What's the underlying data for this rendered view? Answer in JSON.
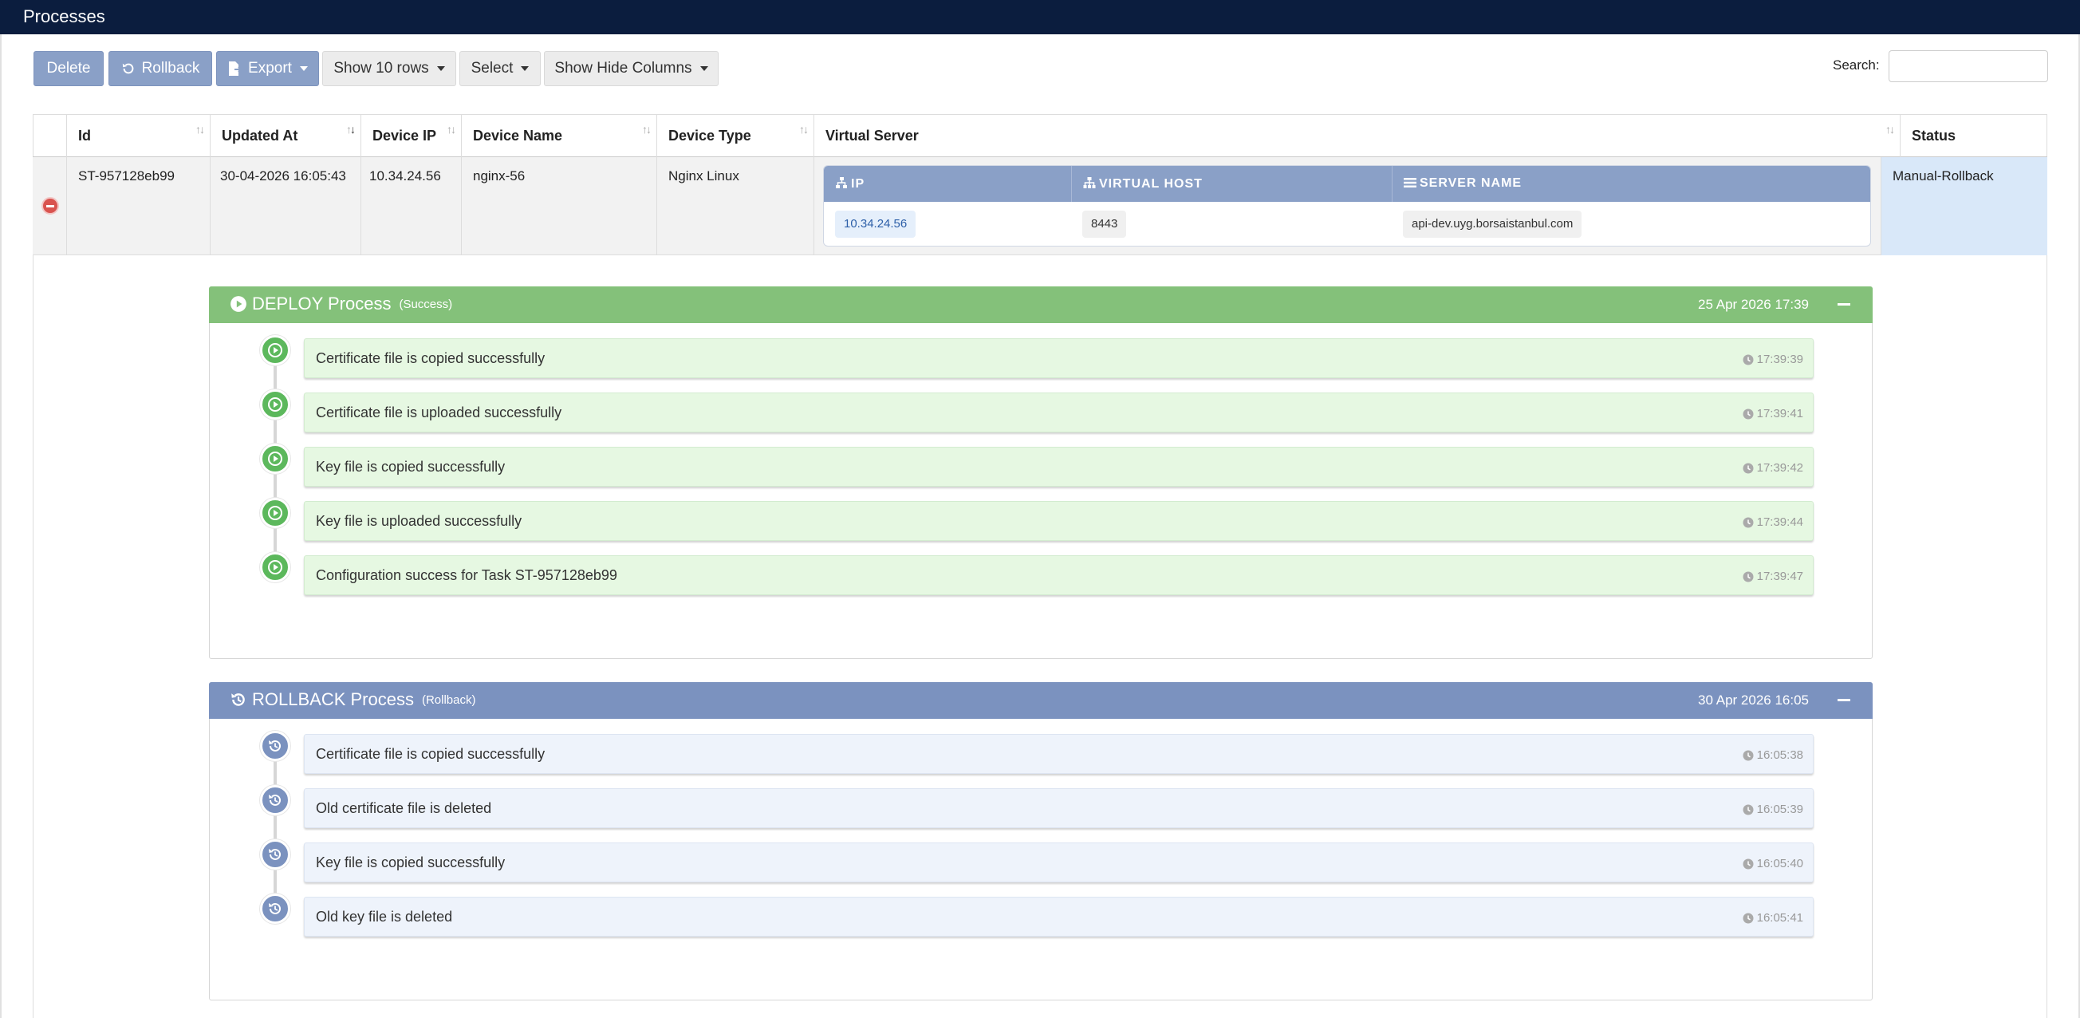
{
  "header": {
    "title": "Processes"
  },
  "toolbar": {
    "delete_label": "Delete",
    "rollback_label": "Rollback",
    "export_label": "Export",
    "rows_label": "Show 10 rows",
    "select_label": "Select",
    "columns_label": "Show Hide Columns",
    "search_label": "Search:",
    "search_value": ""
  },
  "table": {
    "columns": [
      "Id",
      "Updated At",
      "Device IP",
      "Device Name",
      "Device Type",
      "Virtual Server",
      "Status"
    ],
    "row": {
      "id": "ST-957128eb99",
      "updated_at": "30-04-2026 16:05:43",
      "device_ip": "10.34.24.56",
      "device_name": "nginx-56",
      "device_type": "Nginx Linux",
      "status": "Manual-Rollback",
      "virtual_server": {
        "headers": [
          "IP",
          "VIRTUAL HOST",
          "SERVER NAME"
        ],
        "ip": "10.34.24.56",
        "virtual_host": "8443",
        "server_name": "api-dev.uyg.borsaistanbul.com"
      }
    }
  },
  "deploy": {
    "title": "DEPLOY Process",
    "state": "(Success)",
    "date": "25 Apr 2026 17:39",
    "color": "#84c17a",
    "steps": [
      {
        "text": "Certificate file is copied successfully",
        "time": "17:39:39"
      },
      {
        "text": "Certificate file is uploaded successfully",
        "time": "17:39:41"
      },
      {
        "text": "Key file is copied successfully",
        "time": "17:39:42"
      },
      {
        "text": "Key file is uploaded successfully",
        "time": "17:39:44"
      },
      {
        "text": "Configuration success for Task ST-957128eb99",
        "time": "17:39:47"
      }
    ]
  },
  "rollback": {
    "title": "ROLLBACK Process",
    "state": "(Rollback)",
    "date": "30 Apr 2026 16:05",
    "color": "#7b92bf",
    "steps": [
      {
        "text": "Certificate file is copied successfully",
        "time": "16:05:38"
      },
      {
        "text": "Old certificate file is deleted",
        "time": "16:05:39"
      },
      {
        "text": "Key file is copied successfully",
        "time": "16:05:40"
      },
      {
        "text": "Old key file is deleted",
        "time": "16:05:41"
      }
    ]
  },
  "icons": {
    "play": "play-circle-icon",
    "history": "history-icon",
    "clock": "clock-icon",
    "remove": "minus-circle-icon",
    "network": "sitemap-icon",
    "list": "list-icon"
  }
}
